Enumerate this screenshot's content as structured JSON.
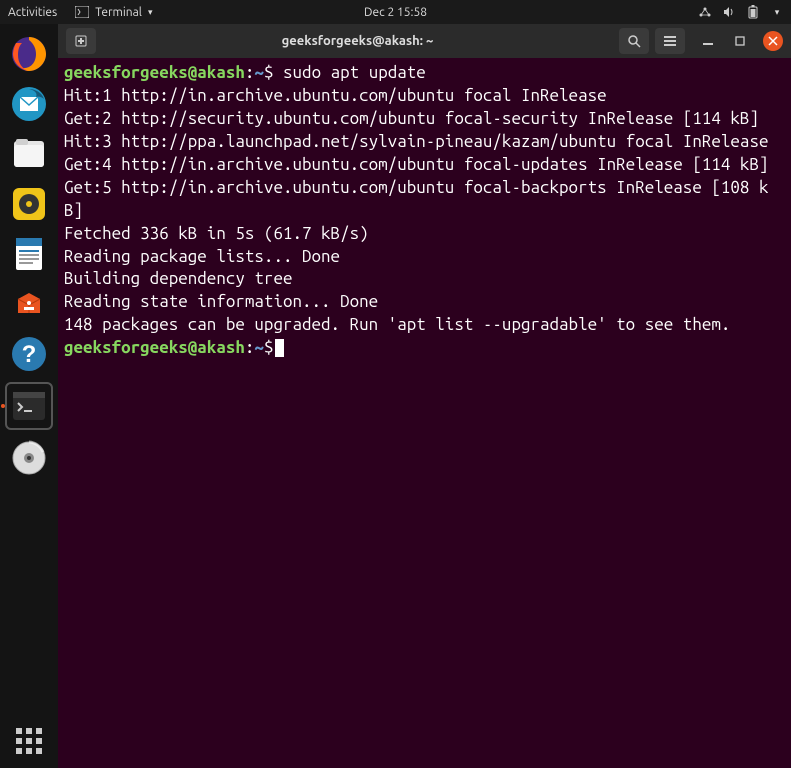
{
  "topbar": {
    "activities": "Activities",
    "appname": "Terminal",
    "datetime": "Dec 2  15:58"
  },
  "dock": {
    "items": [
      {
        "name": "firefox-icon"
      },
      {
        "name": "thunderbird-icon"
      },
      {
        "name": "files-icon"
      },
      {
        "name": "rhythmbox-icon"
      },
      {
        "name": "writer-icon"
      },
      {
        "name": "software-icon"
      },
      {
        "name": "help-icon"
      },
      {
        "name": "terminal-icon"
      },
      {
        "name": "disc-icon"
      }
    ]
  },
  "window": {
    "title": "geeksforgeeks@akash: ~"
  },
  "terminal": {
    "prompt_user": "geeksforgeeks@akash",
    "prompt_sep1": ":",
    "prompt_path": "~",
    "prompt_sep2": "$",
    "command1": "sudo apt update",
    "lines": [
      "Hit:1 http://in.archive.ubuntu.com/ubuntu focal InRelease",
      "Get:2 http://security.ubuntu.com/ubuntu focal-security InRelease [114 kB]",
      "Hit:3 http://ppa.launchpad.net/sylvain-pineau/kazam/ubuntu focal InRelease",
      "Get:4 http://in.archive.ubuntu.com/ubuntu focal-updates InRelease [114 kB]",
      "Get:5 http://in.archive.ubuntu.com/ubuntu focal-backports InRelease [108 kB]",
      "Fetched 336 kB in 5s (61.7 kB/s)",
      "Reading package lists... Done",
      "Building dependency tree",
      "Reading state information... Done",
      "148 packages can be upgraded. Run 'apt list --upgradable' to see them."
    ]
  }
}
